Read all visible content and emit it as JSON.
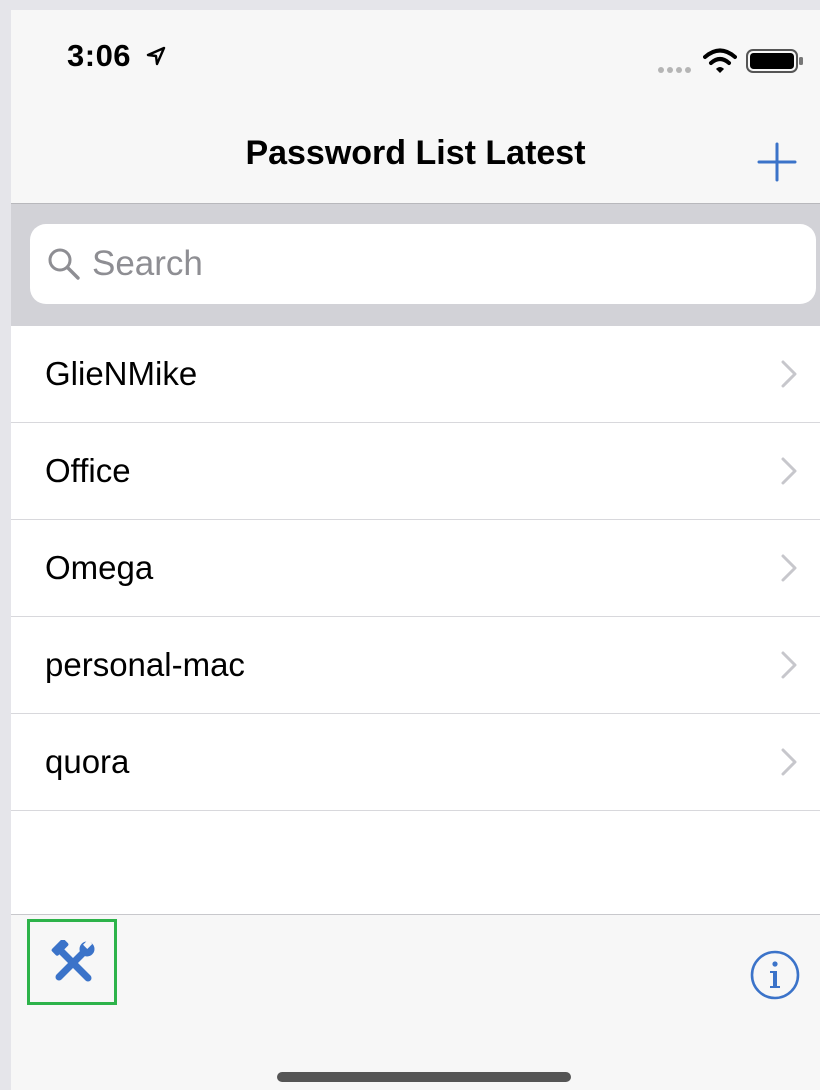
{
  "status_bar": {
    "time": "3:06"
  },
  "nav": {
    "title": "Password List Latest"
  },
  "search": {
    "placeholder": "Search",
    "value": ""
  },
  "list": {
    "items": [
      {
        "label": "GlieNMike"
      },
      {
        "label": "Office"
      },
      {
        "label": "Omega"
      },
      {
        "label": "personal-mac"
      },
      {
        "label": "quora"
      }
    ]
  },
  "colors": {
    "accent": "#3b73c9",
    "highlight_border": "#2db34a",
    "chevron": "#c7c7cc",
    "placeholder": "#8e8e93"
  },
  "icons": {
    "add": "plus-icon",
    "tools": "tools-icon",
    "info": "info-icon",
    "search": "search-icon",
    "chevron": "chevron-right-icon"
  }
}
